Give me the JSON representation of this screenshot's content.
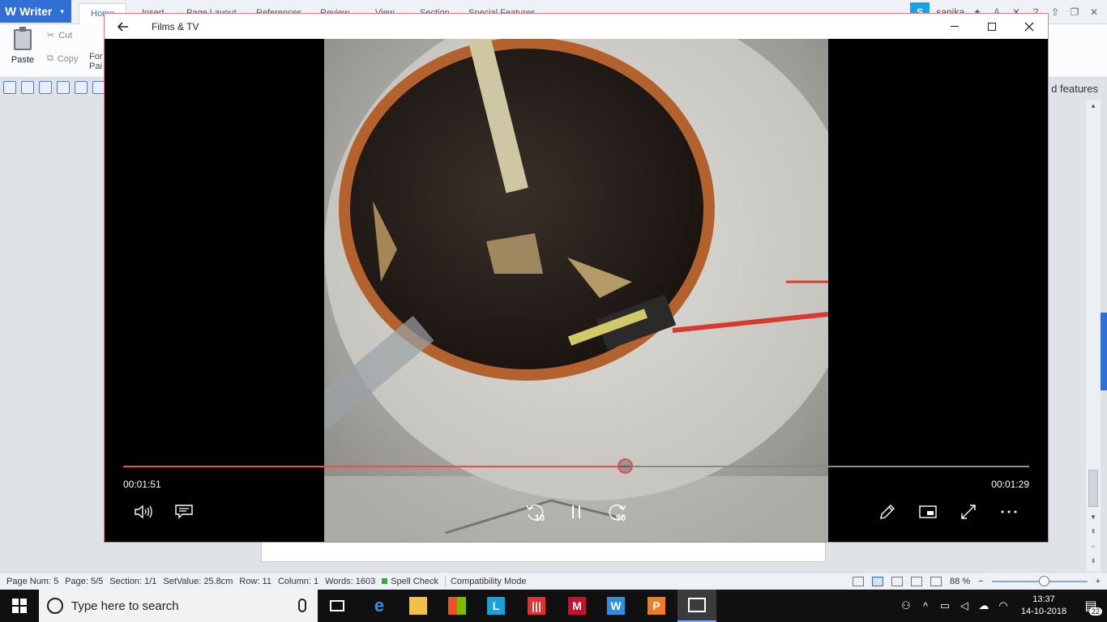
{
  "writer": {
    "app_name": "Writer",
    "tabs": [
      "Home",
      "Insert",
      "Page Layout",
      "References",
      "Review",
      "View",
      "Section",
      "Special Features"
    ],
    "user_name": "sanika",
    "ribbon": {
      "paste": "Paste",
      "cut": "Cut",
      "copy": "Copy",
      "format_painter_line1": "For",
      "format_painter_line2": "Pai",
      "advanced_features": "d features"
    },
    "status_bar": {
      "page_num": "Page Num: 5",
      "page": "Page: 5/5",
      "section": "Section: 1/1",
      "set_value": "SetValue: 25.8cm",
      "row": "Row: 11",
      "column": "Column: 1",
      "words": "Words: 1603",
      "spell_check": "Spell Check",
      "compatibility": "Compatibility Mode",
      "zoom": "88 %",
      "zoom_level": 0.55
    }
  },
  "player": {
    "title": "Films & TV",
    "elapsed": "00:01:51",
    "remaining": "00:01:29",
    "progress": 0.555,
    "skip_back": "10",
    "skip_forward": "30"
  },
  "taskbar": {
    "search_placeholder": "Type here to search",
    "time": "13:37",
    "date": "14-10-2018",
    "notifications": "22",
    "accent": "#101010"
  }
}
